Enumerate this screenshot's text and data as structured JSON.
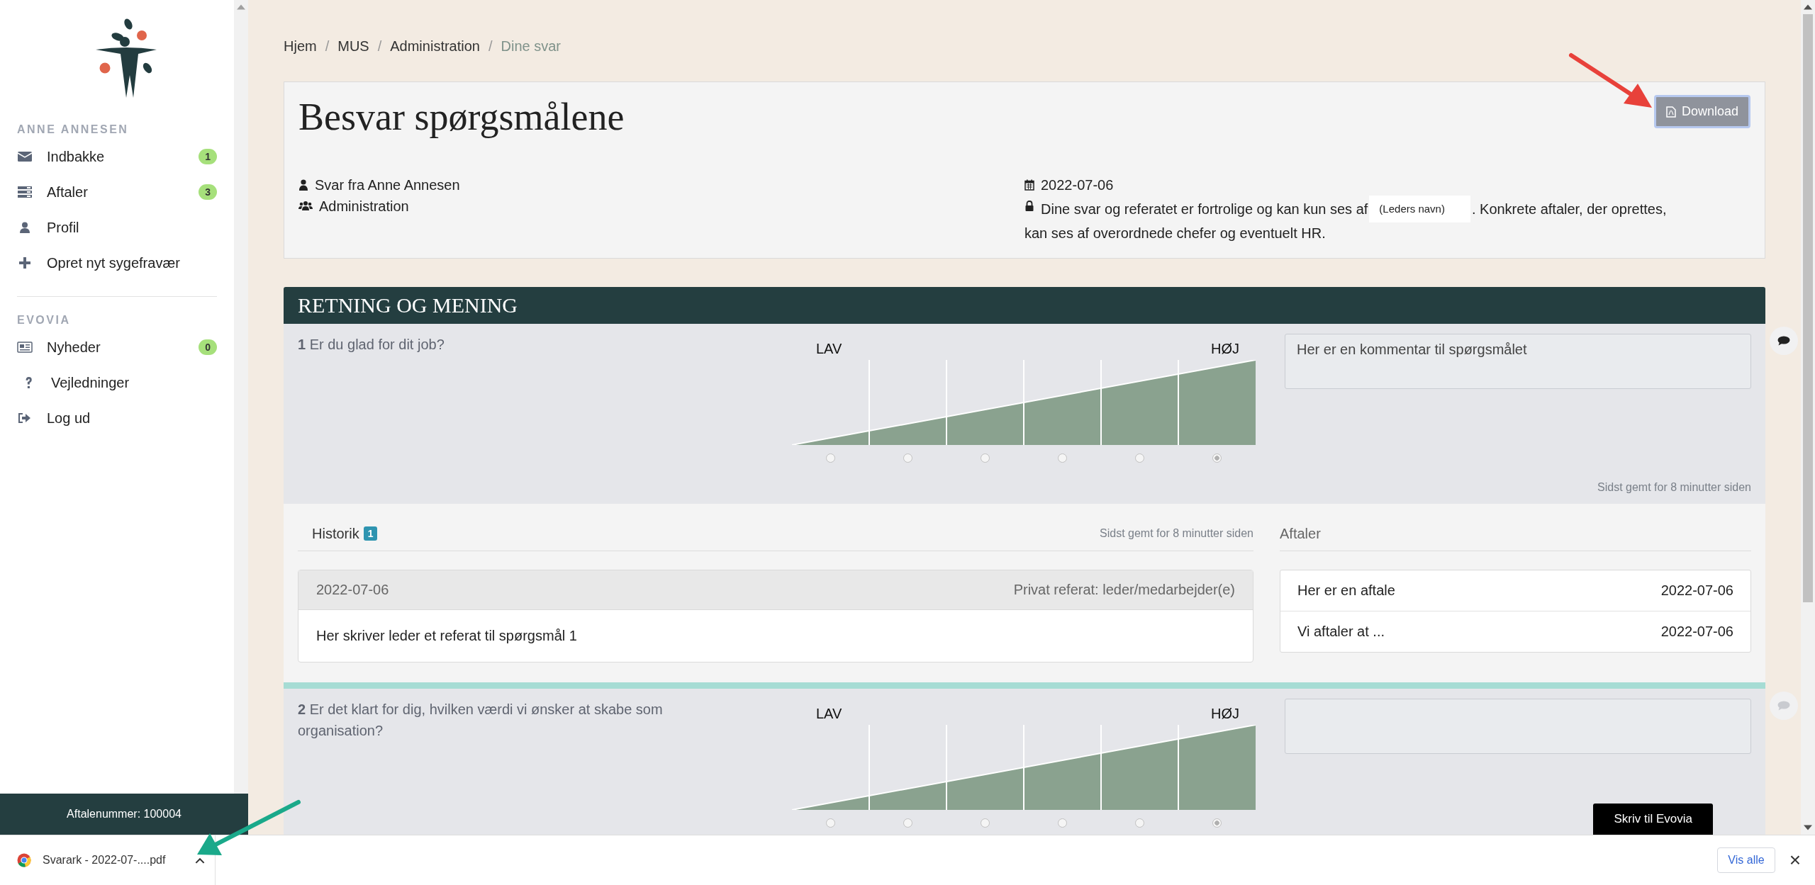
{
  "sidebar": {
    "user_heading": "ANNE ANNESEN",
    "user_items": [
      {
        "kind": "envelope",
        "label": "Indbakke",
        "badge": "1"
      },
      {
        "kind": "list",
        "label": "Aftaler",
        "badge": "3"
      },
      {
        "kind": "user",
        "label": "Profil"
      },
      {
        "kind": "plus",
        "label": "Opret nyt sygefravær"
      }
    ],
    "org_heading": "EVOVIA",
    "org_items": [
      {
        "kind": "news",
        "label": "Nyheder",
        "badge": "0"
      },
      {
        "kind": "question",
        "label": "Vejledninger"
      },
      {
        "kind": "logout",
        "label": "Log ud"
      }
    ],
    "agreement_number": "Aftalenummer: 100004"
  },
  "breadcrumb": {
    "separator": "/",
    "items": [
      {
        "label": "Hjem",
        "current": false
      },
      {
        "label": "MUS",
        "current": false
      },
      {
        "label": "Administration",
        "current": false
      },
      {
        "label": "Dine svar",
        "current": true
      }
    ]
  },
  "header": {
    "title": "Besvar spørgsmålene",
    "download_button": "Download",
    "respondent": "Svar fra Anne Annesen",
    "department": "Administration",
    "date": "2022-07-06",
    "privacy_before": "Dine svar og referatet er fortrolige og kan kun ses af",
    "leader_name_placeholder": "(Leders navn)",
    "privacy_after": ". Konkrete aftaler, der oprettes,",
    "privacy_line2": "kan ses af overordnede chefer og eventuelt HR."
  },
  "section": {
    "title": "RETNING OG MENING",
    "questions": [
      {
        "number": "1",
        "text": "Er du glad for dit job?",
        "low_label": "LAV",
        "high_label": "HØJ",
        "options": [
          {
            "selected": false
          },
          {
            "selected": false
          },
          {
            "selected": false
          },
          {
            "selected": false
          },
          {
            "selected": false
          },
          {
            "selected": true
          }
        ],
        "comment": "Her er en kommentar til spørgsmålet",
        "has_comment": true,
        "saved_note": "Sidst gemt for 8 minutter siden",
        "history": {
          "title": "Historik",
          "count": "1",
          "saved_note": "Sidst gemt for 8 minutter siden",
          "entries": [
            {
              "date": "2022-07-06",
              "type": "Privat referat: leder/medarbejder(e)",
              "text": "Her skriver leder et referat til spørgsmål 1"
            }
          ]
        },
        "agreements": {
          "title": "Aftaler",
          "items": [
            {
              "text": "Her er en aftale",
              "date": "2022-07-06"
            },
            {
              "text": "Vi aftaler at ...",
              "date": "2022-07-06"
            }
          ]
        }
      },
      {
        "number": "2",
        "text": "Er det klart for dig, hvilken værdi vi ønsker at skabe som organisation?",
        "low_label": "LAV",
        "high_label": "HØJ",
        "options": [
          {
            "selected": false
          },
          {
            "selected": false
          },
          {
            "selected": false
          },
          {
            "selected": false
          },
          {
            "selected": false
          },
          {
            "selected": true
          }
        ],
        "has_comment": false
      }
    ]
  },
  "chat_button": "Skriv til Evovia",
  "download_bar": {
    "file": "Svarark - 2022-07-....pdf",
    "show_all": "Vis alle",
    "close": "×"
  }
}
